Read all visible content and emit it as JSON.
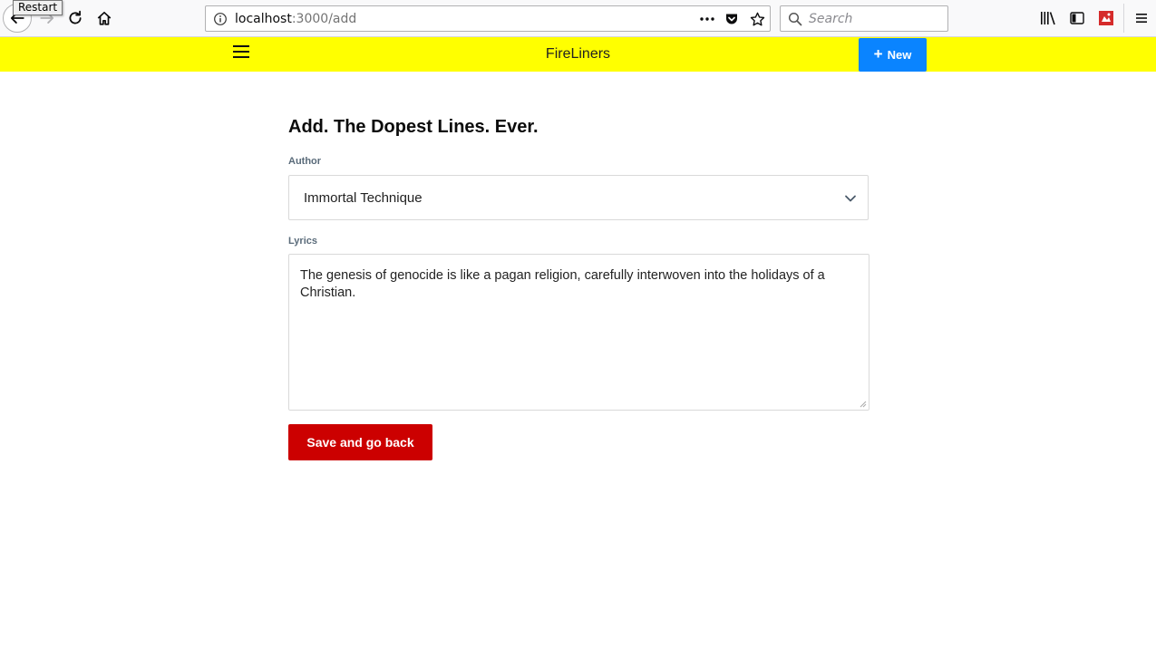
{
  "browser": {
    "tooltip": "Restart",
    "url_host": "localhost",
    "url_path": ":3000/add",
    "search_placeholder": "Search",
    "icons": [
      "back-icon",
      "forward-icon",
      "reload-icon",
      "home-icon",
      "info-icon",
      "more-icon",
      "pocket-icon",
      "star-icon",
      "search-icon",
      "library-icon",
      "sidebar-icon",
      "extension-icon",
      "menu-icon"
    ]
  },
  "navbar": {
    "brand": "FireLiners",
    "new_button": "New",
    "background": "#ffff00",
    "new_button_color": "#0a84ff"
  },
  "form": {
    "title": "Add. The Dopest Lines. Ever.",
    "author_label": "Author",
    "author_value": "Immortal Technique",
    "lyrics_label": "Lyrics",
    "lyrics_value": "The genesis of genocide is like a pagan religion, carefully interwoven  into the holidays of a Christian.",
    "save_button": "Save and go back",
    "save_button_color": "#cc0000"
  }
}
